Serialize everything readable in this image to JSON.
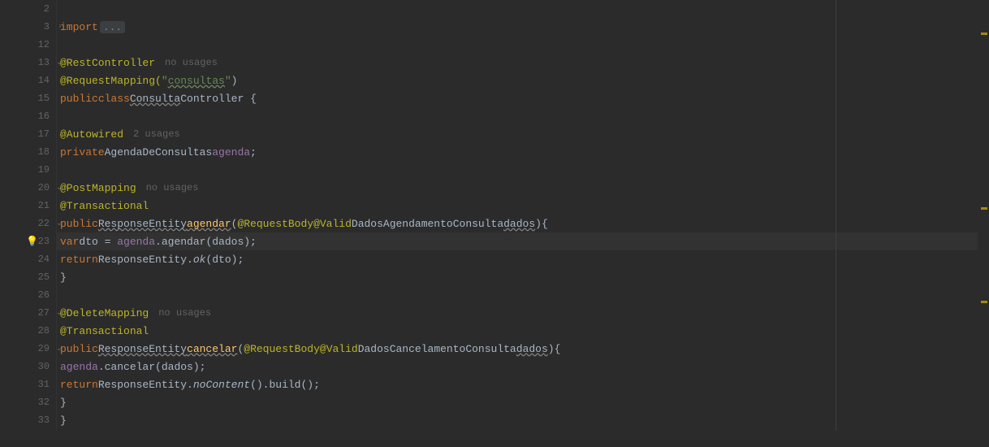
{
  "gutter": {
    "lines": [
      "2",
      "3",
      "12",
      "13",
      "14",
      "15",
      "16",
      "17",
      "18",
      "19",
      "20",
      "21",
      "22",
      "23",
      "24",
      "25",
      "26",
      "27",
      "28",
      "29",
      "30",
      "31",
      "32",
      "33",
      ""
    ],
    "fold_rows": [
      1,
      3,
      10,
      12,
      17,
      19
    ],
    "fold_closed_rows": [
      1
    ],
    "bulb_row": 13,
    "highlight_row": 13
  },
  "code": {
    "import_kw": "import",
    "ellipsis": "...",
    "rest_controller": "@RestController",
    "no_usages": "no usages",
    "two_usages": "2 usages",
    "request_mapping_open": "@RequestMapping(",
    "open_quote": "\"",
    "consultas": "consultas",
    "close_quote": "\"",
    "close_paren": ")",
    "public": "public",
    "class": "class",
    "consulta": "Consulta",
    "controller": "Controller",
    "open_brace": " {",
    "autowired": "@Autowired",
    "private": "private",
    "agenda_type": "AgendaDeConsultas",
    "agenda_field": "agenda",
    "semicolon": ";",
    "post_mapping": "@PostMapping",
    "transactional": "@Transactional",
    "response_entity": "ResponseEntity",
    "agendar": "agendar",
    "method_open": "(",
    "request_body": "@RequestBody",
    "valid": "@Valid",
    "dados_agendamento": "DadosAgendamentoConsulta",
    "dados": "dados",
    "method_close_brace": "){",
    "var": "var",
    "dto": "dto",
    "equals": " = ",
    "dot": ".",
    "agendar_call": "agendar",
    "call_args": "(dados);",
    "return": "return",
    "ok": "ok",
    "ok_args": "(dto);",
    "close_method_brace": "}",
    "delete_mapping": "@DeleteMapping",
    "cancelar": "cancelar",
    "dados_cancelamento": "DadosCancelamentoConsulta",
    "cancelar_call": "cancelar",
    "no_content": "noContent",
    "no_content_suffix": "().build();",
    "close_class_brace": "}"
  },
  "rail_marks": [
    40,
    255,
    370
  ]
}
